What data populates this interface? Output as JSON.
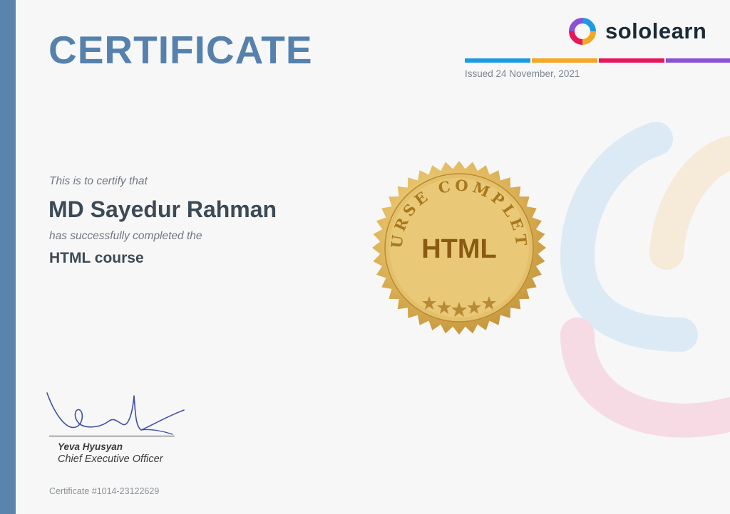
{
  "certificate": {
    "title": "CERTIFICATE",
    "issued": "Issued 24 November, 2021",
    "intro": "This is to certify that",
    "recipient": "MD Sayedur Rahman",
    "completed_text": "has successfully completed the",
    "course": "HTML course",
    "number": "Certificate #1014-23122629"
  },
  "brand": {
    "name": "sololearn",
    "logo_icon": "sololearn-logo-icon",
    "stripe_colors": [
      "#1e9be0",
      "#f5a623",
      "#e8175d",
      "#8e4fd4"
    ]
  },
  "seal": {
    "label": "HTML",
    "ring_text": "COURSE COMPLETED",
    "icon": "gold-seal-icon"
  },
  "signatory": {
    "name": "Yeva Hyusyan",
    "title": "Chief Executive Officer",
    "icon": "signature-icon"
  },
  "colors": {
    "title_blue": "#5681ad",
    "left_band": "#5b84ad",
    "text_dark": "#3d4a55"
  }
}
